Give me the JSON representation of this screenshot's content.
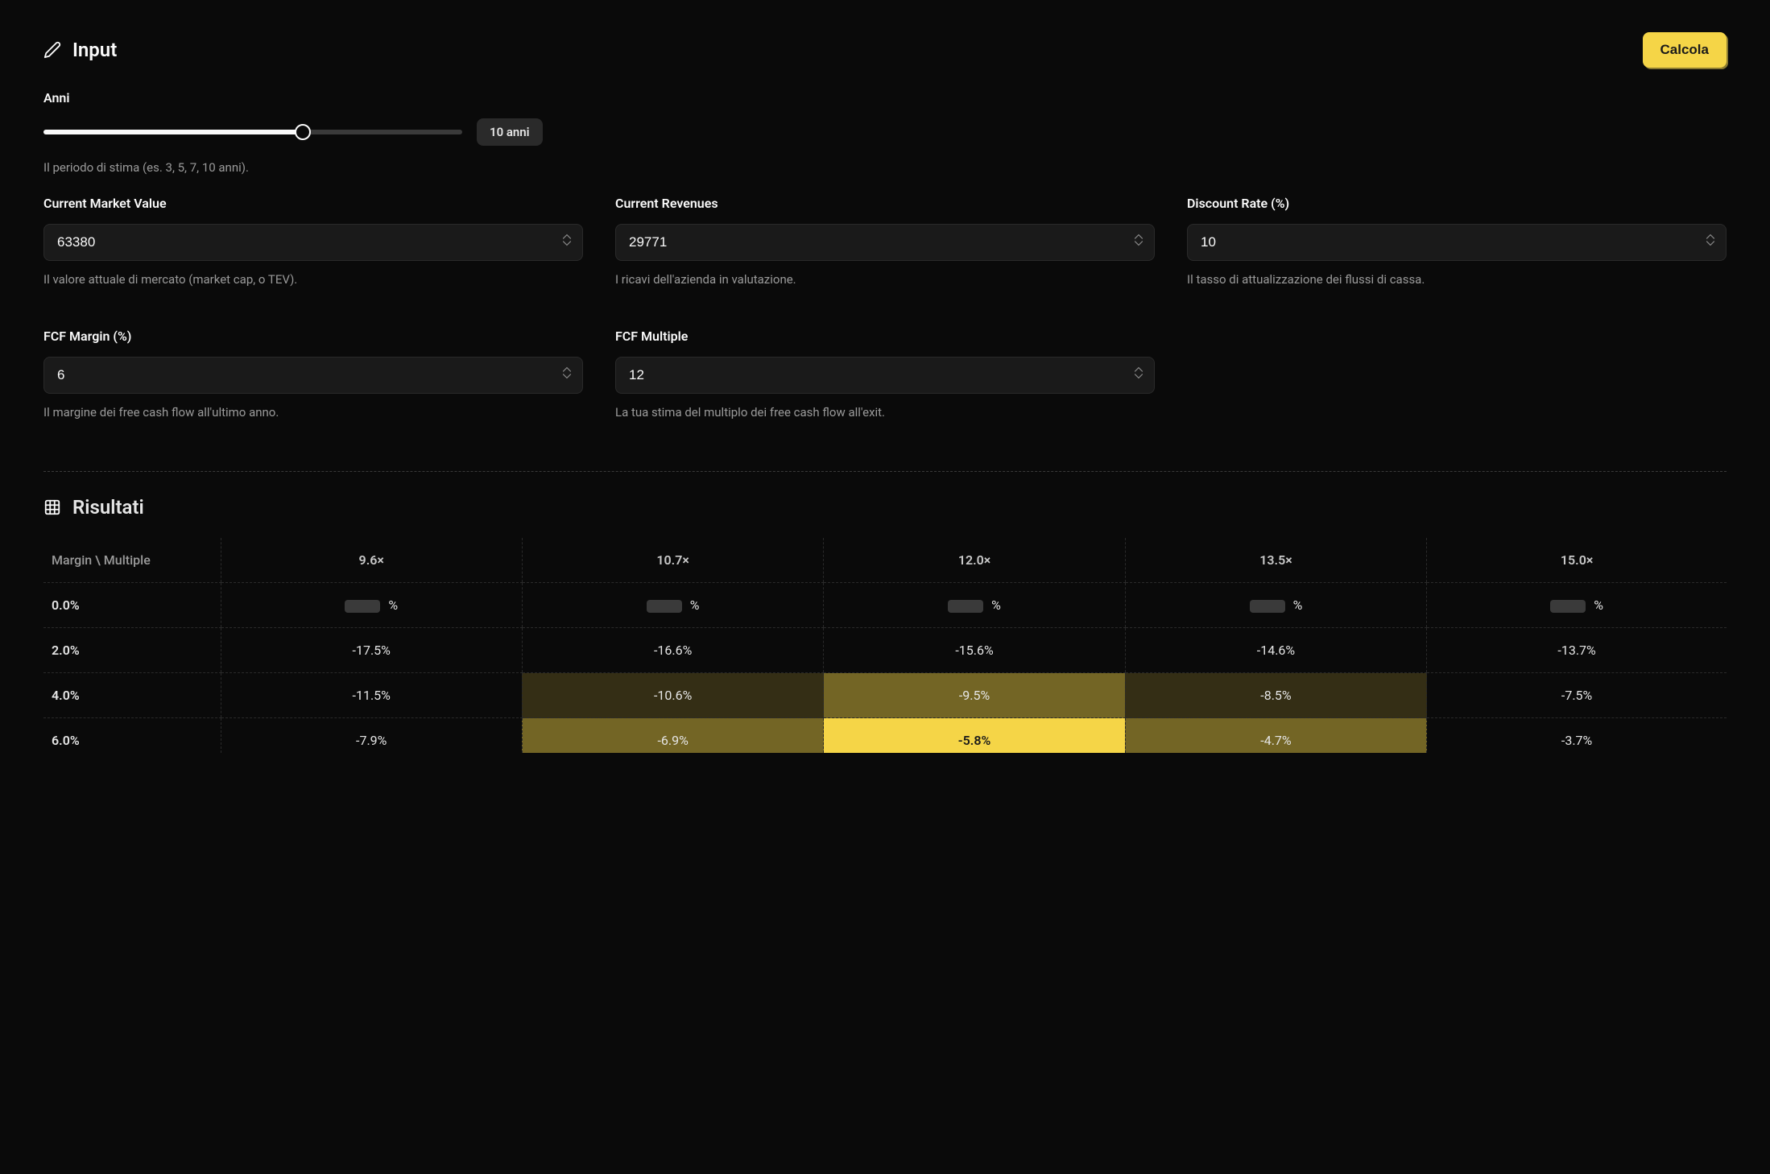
{
  "header": {
    "input_title": "Input",
    "calc_button": "Calcola"
  },
  "slider": {
    "label": "Anni",
    "badge": "10 anni",
    "helper": "Il periodo di stima (es. 3, 5, 7, 10 anni)."
  },
  "fields": {
    "market_value": {
      "label": "Current Market Value",
      "value": "63380",
      "helper": "Il valore attuale di mercato (market cap, o TEV)."
    },
    "revenues": {
      "label": "Current Revenues",
      "value": "29771",
      "helper": "I ricavi dell'azienda in valutazione."
    },
    "discount": {
      "label": "Discount Rate (%)",
      "value": "10",
      "helper": "Il tasso di attualizzazione dei flussi di cassa."
    },
    "fcf_margin": {
      "label": "FCF Margin (%)",
      "value": "6",
      "helper": "Il margine dei free cash flow all'ultimo anno."
    },
    "fcf_multiple": {
      "label": "FCF Multiple",
      "value": "12",
      "helper": "La tua stima del multiplo dei free cash flow all'exit."
    }
  },
  "results": {
    "title": "Risultati",
    "corner": "Margin \\ Multiple",
    "multiples": [
      "9.6×",
      "10.7×",
      "12.0×",
      "13.5×",
      "15.0×"
    ],
    "rows": [
      {
        "margin": "0.0%",
        "cells": [
          null,
          null,
          null,
          null,
          null
        ]
      },
      {
        "margin": "2.0%",
        "cells": [
          "-17.5%",
          "-16.6%",
          "-15.6%",
          "-14.6%",
          "-13.7%"
        ]
      },
      {
        "margin": "4.0%",
        "cells": [
          "-11.5%",
          "-10.6%",
          "-9.5%",
          "-8.5%",
          "-7.5%"
        ],
        "hl": [
          null,
          "low",
          "mid",
          "low",
          null
        ]
      },
      {
        "margin": "6.0%",
        "cells": [
          "-7.9%",
          "-6.9%",
          "-5.8%",
          "-4.7%",
          "-3.7%"
        ],
        "hl": [
          null,
          "mid",
          "high",
          "mid",
          null
        ]
      }
    ]
  }
}
